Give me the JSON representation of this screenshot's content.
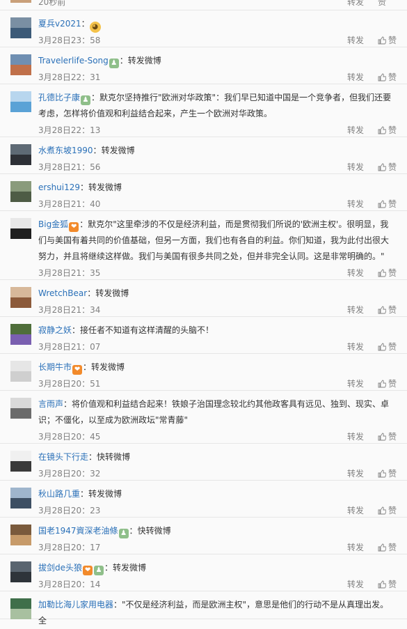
{
  "top_row": {
    "time": "20秒前",
    "repost_label": "转发",
    "like_label": "赞"
  },
  "comments": [
    {
      "user": "夏兵v2021",
      "separator": "：",
      "text": "",
      "emoji": "doge-emoji",
      "badges": [],
      "time": "3月28日23：58",
      "repost_label": "转发",
      "like_label": "赞",
      "avatar_colors": [
        "#7a8fa3",
        "#3c5a78"
      ]
    },
    {
      "user": "Travelerlife-Song",
      "separator": "：",
      "text": "转发微博",
      "badges": [
        "green"
      ],
      "time": "3月28日22：31",
      "repost_label": "转发",
      "like_label": "赞",
      "avatar_colors": [
        "#6f8fb2",
        "#c0704a"
      ]
    },
    {
      "user": "孔德比子康",
      "separator": "：",
      "text": "默克尔坚持推行\"欧洲对华政策\"：我们早已知道中国是一个竞争者，但我们还要考虑，怎样将价值观和利益结合起来，产生一个欧洲对华政策。",
      "badges": [
        "green"
      ],
      "time": "3月28日22：13",
      "repost_label": "转发",
      "like_label": "赞",
      "avatar_colors": [
        "#b8d6ee",
        "#5aa2d6"
      ]
    },
    {
      "user": "水煮东坡1990",
      "separator": "：",
      "text": "转发微博",
      "badges": [],
      "time": "3月28日21：56",
      "repost_label": "转发",
      "like_label": "赞",
      "avatar_colors": [
        "#5e6a75",
        "#2d3036"
      ]
    },
    {
      "user": "ershui129",
      "separator": "：",
      "text": "转发微博",
      "badges": [],
      "time": "3月28日21：40",
      "repost_label": "转发",
      "like_label": "赞",
      "avatar_colors": [
        "#8a9b7c",
        "#4e5c45"
      ]
    },
    {
      "user": "Big金狐",
      "separator": "：",
      "text": "默克尔\"这里牵涉的不仅是经济利益，而是贯彻我们所说的'欧洲主权'。很明显，我们与美国有着共同的价值基础，但另一方面，我们也有各自的利益。你们知道，我为此付出很大努力，并且将继续这样做。我们与美国有很多共同之处，但并非完全认同。这是非常明确的。\"",
      "badges": [
        "orange"
      ],
      "time": "3月28日21：35",
      "repost_label": "转发",
      "like_label": "赞",
      "avatar_colors": [
        "#e8e8e8",
        "#1f1f1f"
      ]
    },
    {
      "user": "WretchBear",
      "separator": "：",
      "text": "转发微博",
      "badges": [],
      "time": "3月28日21：34",
      "repost_label": "转发",
      "like_label": "赞",
      "avatar_colors": [
        "#d7b89a",
        "#8c5a3a"
      ]
    },
    {
      "user": "寂静之妖",
      "separator": "：",
      "text": "接任者不知道有这样清醒的头脑不！",
      "badges": [],
      "time": "3月28日21：07",
      "repost_label": "转发",
      "like_label": "赞",
      "avatar_colors": [
        "#4f6e3a",
        "#7a5fb0"
      ]
    },
    {
      "user": "长期牛市",
      "separator": "：",
      "text": "转发微博",
      "badges": [
        "orange"
      ],
      "time": "3月28日20：51",
      "repost_label": "转发",
      "like_label": "赞",
      "avatar_colors": [
        "#e6e6e6",
        "#cfcfcf"
      ]
    },
    {
      "user": "言雨声",
      "separator": "：",
      "text": "将价值观和利益结合起来！铁娘子治国理念较北约其他政客具有远见、独到、现实、卓识；不僵化，以至成为欧洲政坛\"常青藤\"",
      "badges": [],
      "time": "3月28日20：45",
      "repost_label": "转发",
      "like_label": "赞",
      "avatar_colors": [
        "#d9d9d9",
        "#6b6b6b"
      ]
    },
    {
      "user": "在镜头下行走",
      "separator": "：",
      "text": "快转微博",
      "badges": [],
      "time": "3月28日20：32",
      "repost_label": "转发",
      "like_label": "赞",
      "avatar_colors": [
        "#f0f0f0",
        "#3a3a3a"
      ]
    },
    {
      "user": "秋山路几重",
      "separator": "：",
      "text": "转发微博",
      "badges": [],
      "time": "3月28日20：23",
      "repost_label": "转发",
      "like_label": "赞",
      "avatar_colors": [
        "#9fb5cc",
        "#3d4f63"
      ]
    },
    {
      "user": "国老1947資深老油條",
      "separator": "：",
      "text": "快转微博",
      "badges": [
        "green"
      ],
      "time": "3月28日20：17",
      "repost_label": "转发",
      "like_label": "赞",
      "avatar_colors": [
        "#7a5a3c",
        "#c79b6a"
      ]
    },
    {
      "user": "拔剑de头狼",
      "separator": "：",
      "text": "转发微博",
      "badges": [
        "orange",
        "green"
      ],
      "time": "3月28日20：14",
      "repost_label": "转发",
      "like_label": "赞",
      "avatar_colors": [
        "#5a6570",
        "#2e343a"
      ]
    },
    {
      "user": "加勒比海儿家用电器",
      "separator": "：",
      "text": "\"不仅是经济利益，而是欧洲主权\"，意思是他们的行动不是从真理出发。全",
      "badges": [],
      "time": "",
      "repost_label": "",
      "like_label": "",
      "avatar_colors": [
        "#3f6f4a",
        "#a8c0a0"
      ]
    }
  ]
}
